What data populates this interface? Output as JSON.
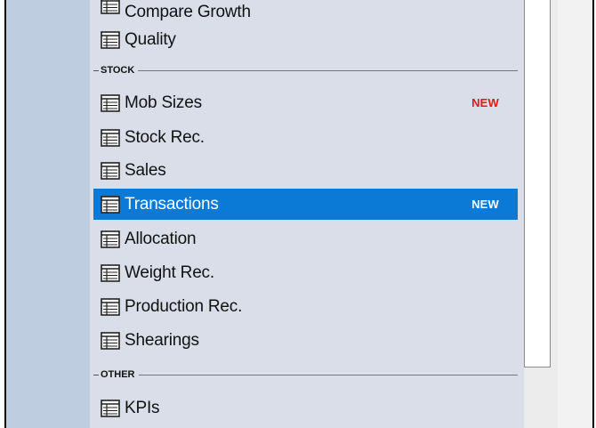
{
  "menu": {
    "items": [
      {
        "label": "Compare Growth",
        "icon": "report-icon"
      },
      {
        "label": "Quality",
        "icon": "report-icon"
      },
      {
        "label": "Mob Sizes",
        "icon": "report-icon",
        "badge": "NEW",
        "badge_color": "#e31818"
      },
      {
        "label": "Stock Rec.",
        "icon": "report-icon"
      },
      {
        "label": "Sales",
        "icon": "report-icon"
      },
      {
        "label": "Transactions",
        "icon": "report-icon",
        "badge": "NEW",
        "selected": true
      },
      {
        "label": "Allocation",
        "icon": "report-icon"
      },
      {
        "label": "Weight Rec.",
        "icon": "report-icon"
      },
      {
        "label": "Production Rec.",
        "icon": "report-icon"
      },
      {
        "label": "Shearings",
        "icon": "report-icon"
      },
      {
        "label": "KPIs",
        "icon": "report-icon"
      }
    ],
    "sections": [
      {
        "title": "STOCK"
      },
      {
        "title": "OTHER"
      }
    ]
  },
  "colors": {
    "selected_bg": "#0a7ad6",
    "panel_bg": "#d9dee8",
    "rail_bg": "#bfcde0",
    "new_badge": "#e31818"
  }
}
